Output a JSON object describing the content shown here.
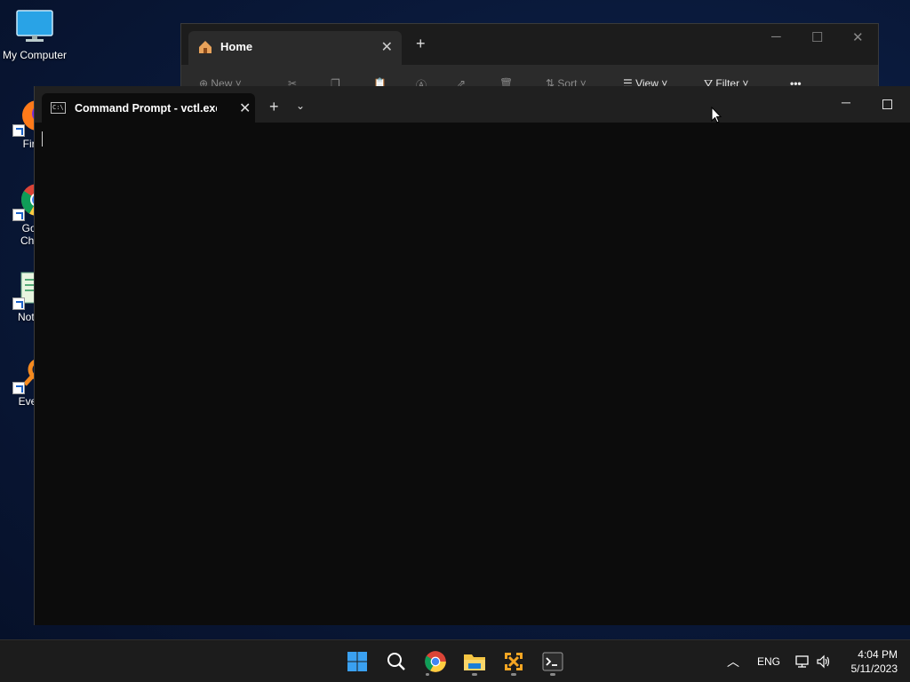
{
  "desktop": {
    "icons": [
      {
        "label": "My Computer"
      },
      {
        "label": "Fire"
      },
      {
        "label": "Goo\nChro"
      },
      {
        "label": "Notep"
      },
      {
        "label": "Every"
      }
    ]
  },
  "explorer": {
    "tab_title": "Home",
    "toolbar": {
      "new_label": "New",
      "sort_label": "Sort",
      "view_label": "View",
      "filter_label": "Filter"
    }
  },
  "terminal": {
    "tab_title": "Command Prompt - vctl.exe",
    "icon_text": "C:\\",
    "console_text": ""
  },
  "taskbar": {
    "apps": [
      "start-icon",
      "search-icon",
      "chrome-icon",
      "file-explorer-icon",
      "vmware-icon",
      "terminal-icon"
    ],
    "tray": {
      "language": "ENG",
      "time": "4:04 PM",
      "date": "5/11/2023"
    }
  },
  "colors": {
    "desktop_bg": "#0a1a3c",
    "taskbar_bg": "#1c1c1c",
    "terminal_bg": "#0c0c0c",
    "titlebar_bg": "#202020"
  }
}
